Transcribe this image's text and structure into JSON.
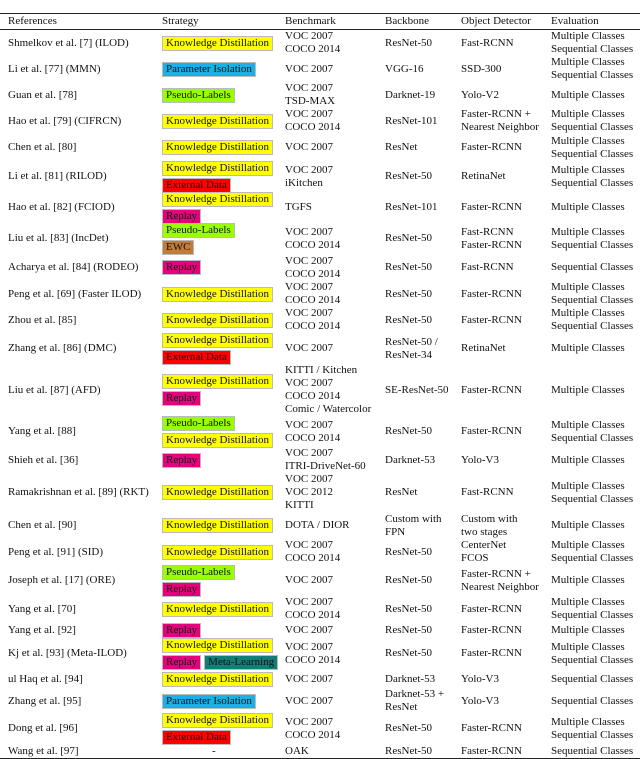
{
  "headers": [
    "References",
    "Strategy",
    "Benchmark",
    "Backbone",
    "Object Detector",
    "Evaluation"
  ],
  "strategy_colors": {
    "Knowledge Distillation": "#ffff00",
    "Parameter Isolation": "#1cb0e8",
    "Pseudo-Labels": "#99ff00",
    "External Data": "#ff0000",
    "Replay": "#e6007e",
    "EWC": "#c27c3a",
    "Meta-Learning": "#0f7f78"
  },
  "rows": [
    {
      "ref": "Shmelkov et al. [7] (ILOD)",
      "strategy": [
        [
          "Knowledge Distillation"
        ]
      ],
      "benchmark": [
        "VOC 2007",
        "COCO 2014"
      ],
      "backbone": [
        "ResNet-50"
      ],
      "detector": [
        "Fast-RCNN"
      ],
      "evaluation": [
        "Multiple Classes",
        "Sequential Classes"
      ]
    },
    {
      "ref": "Li et al. [77] (MMN)",
      "strategy": [
        [
          "Parameter Isolation"
        ]
      ],
      "benchmark": [
        "VOC 2007"
      ],
      "backbone": [
        "VGG-16"
      ],
      "detector": [
        "SSD-300"
      ],
      "evaluation": [
        "Multiple Classes",
        "Sequential Classes"
      ]
    },
    {
      "ref": "Guan et al. [78]",
      "strategy": [
        [
          "Pseudo-Labels"
        ]
      ],
      "benchmark": [
        "VOC 2007",
        "TSD-MAX"
      ],
      "backbone": [
        "Darknet-19"
      ],
      "detector": [
        "Yolo-V2"
      ],
      "evaluation": [
        "Multiple Classes"
      ]
    },
    {
      "ref": "Hao et al. [79] (CIFRCN)",
      "strategy": [
        [
          "Knowledge Distillation"
        ]
      ],
      "benchmark": [
        "VOC 2007",
        "COCO 2014"
      ],
      "backbone": [
        "ResNet-101"
      ],
      "detector": [
        "Faster-RCNN +",
        "Nearest Neighbor"
      ],
      "evaluation": [
        "Multiple Classes",
        "Sequential Classes"
      ]
    },
    {
      "ref": "Chen et al. [80]",
      "strategy": [
        [
          "Knowledge Distillation"
        ]
      ],
      "benchmark": [
        "VOC 2007"
      ],
      "backbone": [
        "ResNet"
      ],
      "detector": [
        "Faster-RCNN"
      ],
      "evaluation": [
        "Multiple Classes",
        "Sequential Classes"
      ]
    },
    {
      "ref": "Li et al. [81] (RILOD)",
      "strategy": [
        [
          "Knowledge Distillation"
        ],
        [
          "External Data"
        ]
      ],
      "benchmark": [
        "VOC 2007",
        "iKitchen"
      ],
      "backbone": [
        "ResNet-50"
      ],
      "detector": [
        "RetinaNet"
      ],
      "evaluation": [
        "Multiple Classes",
        "Sequential Classes"
      ]
    },
    {
      "ref": "Hao et al. [82] (FCIOD)",
      "strategy": [
        [
          "Knowledge Distillation"
        ],
        [
          "Replay"
        ]
      ],
      "benchmark": [
        "TGFS"
      ],
      "backbone": [
        "ResNet-101"
      ],
      "detector": [
        "Faster-RCNN"
      ],
      "evaluation": [
        "Multiple Classes"
      ]
    },
    {
      "ref": "Liu et al. [83] (IncDet)",
      "strategy": [
        [
          "Pseudo-Labels"
        ],
        [
          "EWC"
        ]
      ],
      "benchmark": [
        "VOC 2007",
        "COCO 2014"
      ],
      "backbone": [
        "ResNet-50"
      ],
      "detector": [
        "Fast-RCNN",
        "Faster-RCNN"
      ],
      "evaluation": [
        "Multiple Classes",
        "Sequential Classes"
      ]
    },
    {
      "ref": "Acharya et al. [84] (RODEO)",
      "strategy": [
        [
          "Replay"
        ]
      ],
      "benchmark": [
        "VOC 2007",
        "COCO 2014"
      ],
      "backbone": [
        "ResNet-50"
      ],
      "detector": [
        "Fast-RCNN"
      ],
      "evaluation": [
        "Sequential Classes"
      ]
    },
    {
      "ref": "Peng et al. [69] (Faster ILOD)",
      "strategy": [
        [
          "Knowledge Distillation"
        ]
      ],
      "benchmark": [
        "VOC 2007",
        "COCO 2014"
      ],
      "backbone": [
        "ResNet-50"
      ],
      "detector": [
        "Faster-RCNN"
      ],
      "evaluation": [
        "Multiple Classes",
        "Sequential Classes"
      ]
    },
    {
      "ref": "Zhou et al. [85]",
      "strategy": [
        [
          "Knowledge Distillation"
        ]
      ],
      "benchmark": [
        "VOC 2007",
        "COCO 2014"
      ],
      "backbone": [
        "ResNet-50"
      ],
      "detector": [
        "Faster-RCNN"
      ],
      "evaluation": [
        "Multiple Classes",
        "Sequential Classes"
      ]
    },
    {
      "ref": "Zhang et al. [86] (DMC)",
      "strategy": [
        [
          "Knowledge Distillation"
        ],
        [
          "External Data"
        ]
      ],
      "benchmark": [
        "VOC 2007"
      ],
      "backbone": [
        "ResNet-50 /",
        "ResNet-34"
      ],
      "detector": [
        "RetinaNet"
      ],
      "evaluation": [
        "Multiple Classes"
      ]
    },
    {
      "ref": "Liu et al. [87] (AFD)",
      "strategy": [
        [
          "Knowledge Distillation"
        ],
        [
          "Replay"
        ]
      ],
      "benchmark": [
        "KITTI / Kitchen",
        "VOC 2007",
        "COCO 2014",
        "Comic / Watercolor"
      ],
      "backbone": [
        "SE-ResNet-50"
      ],
      "detector": [
        "Faster-RCNN"
      ],
      "evaluation": [
        "Multiple Classes"
      ]
    },
    {
      "ref": "Yang et al. [88]",
      "strategy": [
        [
          "Pseudo-Labels"
        ],
        [
          "Knowledge Distillation"
        ]
      ],
      "benchmark": [
        "VOC 2007",
        "COCO 2014"
      ],
      "backbone": [
        "ResNet-50"
      ],
      "detector": [
        "Faster-RCNN"
      ],
      "evaluation": [
        "Multiple Classes",
        "Sequential Classes"
      ]
    },
    {
      "ref": "Shieh et al. [36]",
      "strategy": [
        [
          "Replay"
        ]
      ],
      "benchmark": [
        "VOC 2007",
        "ITRI-DriveNet-60"
      ],
      "backbone": [
        "Darknet-53"
      ],
      "detector": [
        "Yolo-V3"
      ],
      "evaluation": [
        "Multiple Classes"
      ]
    },
    {
      "ref": "Ramakrishnan et al. [89] (RKT)",
      "strategy": [
        [
          "Knowledge Distillation"
        ]
      ],
      "benchmark": [
        "VOC 2007",
        "VOC 2012",
        "KITTI"
      ],
      "backbone": [
        "ResNet"
      ],
      "detector": [
        "Fast-RCNN"
      ],
      "evaluation": [
        "Multiple Classes",
        "Sequential Classes"
      ]
    },
    {
      "ref": "Chen et al. [90]",
      "strategy": [
        [
          "Knowledge Distillation"
        ]
      ],
      "benchmark": [
        "DOTA / DIOR"
      ],
      "backbone": [
        "Custom with",
        "FPN"
      ],
      "detector": [
        "Custom with",
        "two stages"
      ],
      "evaluation": [
        "Multiple Classes"
      ]
    },
    {
      "ref": "Peng et al. [91] (SID)",
      "strategy": [
        [
          "Knowledge Distillation"
        ]
      ],
      "benchmark": [
        "VOC 2007",
        "COCO 2014"
      ],
      "backbone": [
        "ResNet-50"
      ],
      "detector": [
        "CenterNet",
        "FCOS"
      ],
      "evaluation": [
        "Multiple Classes",
        "Sequential Classes"
      ]
    },
    {
      "ref": "Joseph et al. [17] (ORE)",
      "strategy": [
        [
          "Pseudo-Labels"
        ],
        [
          "Replay"
        ]
      ],
      "benchmark": [
        "VOC 2007"
      ],
      "backbone": [
        "ResNet-50"
      ],
      "detector": [
        "Faster-RCNN +",
        "Nearest Neighbor"
      ],
      "evaluation": [
        "Multiple Classes"
      ]
    },
    {
      "ref": "Yang et al. [70]",
      "strategy": [
        [
          "Knowledge Distillation"
        ]
      ],
      "benchmark": [
        "VOC 2007",
        "COCO 2014"
      ],
      "backbone": [
        "ResNet-50"
      ],
      "detector": [
        "Faster-RCNN"
      ],
      "evaluation": [
        "Multiple Classes",
        "Sequential Classes"
      ]
    },
    {
      "ref": "Yang et al. [92]",
      "strategy": [
        [
          "Replay"
        ]
      ],
      "benchmark": [
        "VOC 2007"
      ],
      "backbone": [
        "ResNet-50"
      ],
      "detector": [
        "Faster-RCNN"
      ],
      "evaluation": [
        "Multiple Classes"
      ]
    },
    {
      "ref": "Kj et al. [93] (Meta-ILOD)",
      "strategy": [
        [
          "Knowledge Distillation"
        ],
        [
          "Replay",
          "Meta-Learning"
        ]
      ],
      "benchmark": [
        "VOC 2007",
        "COCO 2014"
      ],
      "backbone": [
        "ResNet-50"
      ],
      "detector": [
        "Faster-RCNN"
      ],
      "evaluation": [
        "Multiple Classes",
        "Sequential Classes"
      ]
    },
    {
      "ref": "ul Haq et al. [94]",
      "strategy": [
        [
          "Knowledge Distillation"
        ]
      ],
      "benchmark": [
        "VOC 2007"
      ],
      "backbone": [
        "Darknet-53"
      ],
      "detector": [
        "Yolo-V3"
      ],
      "evaluation": [
        "Sequential Classes"
      ]
    },
    {
      "ref": "Zhang et al. [95]",
      "strategy": [
        [
          "Parameter Isolation"
        ]
      ],
      "benchmark": [
        "VOC 2007"
      ],
      "backbone": [
        "Darknet-53 +",
        "ResNet"
      ],
      "detector": [
        "Yolo-V3"
      ],
      "evaluation": [
        "Sequential Classes"
      ]
    },
    {
      "ref": "Dong et al. [96]",
      "strategy": [
        [
          "Knowledge Distillation"
        ],
        [
          "External Data"
        ]
      ],
      "benchmark": [
        "VOC 2007",
        "COCO 2014"
      ],
      "backbone": [
        "ResNet-50"
      ],
      "detector": [
        "Faster-RCNN"
      ],
      "evaluation": [
        "Multiple Classes",
        "Sequential Classes"
      ]
    },
    {
      "ref": "Wang et al. [97]",
      "strategy": "-",
      "benchmark": [
        "OAK"
      ],
      "backbone": [
        "ResNet-50"
      ],
      "detector": [
        "Faster-RCNN"
      ],
      "evaluation": [
        "Sequential Classes"
      ]
    }
  ]
}
